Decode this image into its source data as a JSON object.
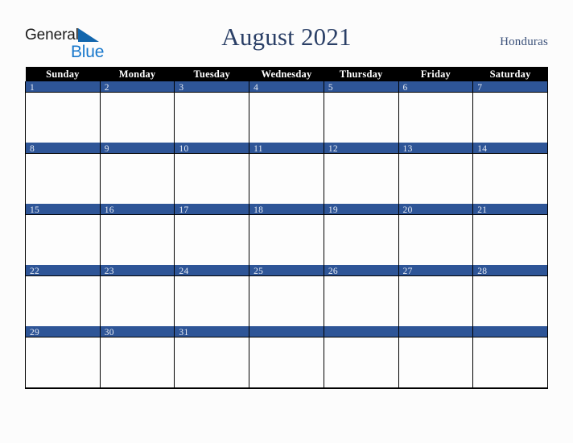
{
  "brand": {
    "name_part1": "General",
    "name_part2": "Blue",
    "triangle_color": "#1266ad",
    "blue_color": "#1878cc",
    "dark_color": "#1a1a1a"
  },
  "header": {
    "title": "August 2021",
    "country": "Honduras",
    "title_color": "#2a3f66",
    "country_color": "#3a5079"
  },
  "calendar": {
    "month": "August",
    "year": "2021",
    "weekday_headers": [
      "Sunday",
      "Monday",
      "Tuesday",
      "Wednesday",
      "Thursday",
      "Friday",
      "Saturday"
    ],
    "header_bg": "#000000",
    "header_text_color": "#ffffff",
    "date_band_bg": "#2e5597",
    "date_text_color": "#e8ecf4",
    "cell_bg": "#fdfdfd",
    "border_color": "#000000",
    "weeks": [
      {
        "days": [
          "1",
          "2",
          "3",
          "4",
          "5",
          "6",
          "7"
        ]
      },
      {
        "days": [
          "8",
          "9",
          "10",
          "11",
          "12",
          "13",
          "14"
        ]
      },
      {
        "days": [
          "15",
          "16",
          "17",
          "18",
          "19",
          "20",
          "21"
        ]
      },
      {
        "days": [
          "22",
          "23",
          "24",
          "25",
          "26",
          "27",
          "28"
        ]
      },
      {
        "days": [
          "29",
          "30",
          "31",
          "",
          "",
          "",
          ""
        ]
      }
    ]
  }
}
